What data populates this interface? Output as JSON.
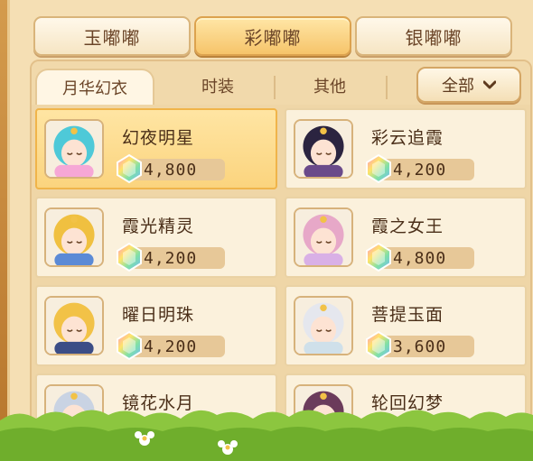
{
  "top_tabs": [
    {
      "label": "玉嘟嘟",
      "active": false
    },
    {
      "label": "彩嘟嘟",
      "active": true
    },
    {
      "label": "银嘟嘟",
      "active": false
    }
  ],
  "sub_tabs": [
    {
      "label": "月华幻衣",
      "active": true
    },
    {
      "label": "时装",
      "active": false
    },
    {
      "label": "其他",
      "active": false
    }
  ],
  "filter": {
    "label": "全部",
    "icon": "chevron-down-icon"
  },
  "items": [
    {
      "name": "幻夜明星",
      "price": "4,800",
      "selected": true,
      "avatar_color": "#f6a7d6",
      "hair_color": "#4ec9d8"
    },
    {
      "name": "彩云追霞",
      "price": "4,200",
      "selected": false,
      "avatar_color": "#6a4a8a",
      "hair_color": "#2b2440"
    },
    {
      "name": "霞光精灵",
      "price": "4,200",
      "selected": false,
      "avatar_color": "#5b8ad6",
      "hair_color": "#f0c040"
    },
    {
      "name": "霞之女王",
      "price": "4,800",
      "selected": false,
      "avatar_color": "#d9b0e6",
      "hair_color": "#e7a8c8"
    },
    {
      "name": "曜日明珠",
      "price": "4,200",
      "selected": false,
      "avatar_color": "#3b4d86",
      "hair_color": "#f2c247"
    },
    {
      "name": "菩提玉面",
      "price": "3,600",
      "selected": false,
      "avatar_color": "#cfe0ea",
      "hair_color": "#e5e7ee"
    },
    {
      "name": "镜花水月",
      "price": "",
      "selected": false,
      "avatar_color": "#dfe6f0",
      "hair_color": "#c9d3e3"
    },
    {
      "name": "轮回幻梦",
      "price": "",
      "selected": false,
      "avatar_color": "#e8d2e4",
      "hair_color": "#6b3b5b"
    }
  ],
  "currency_icon": "rainbow-gem-icon",
  "colors": {
    "accent": "#f6c46a",
    "text": "#4a2e18",
    "panel": "#f5dfb4"
  }
}
